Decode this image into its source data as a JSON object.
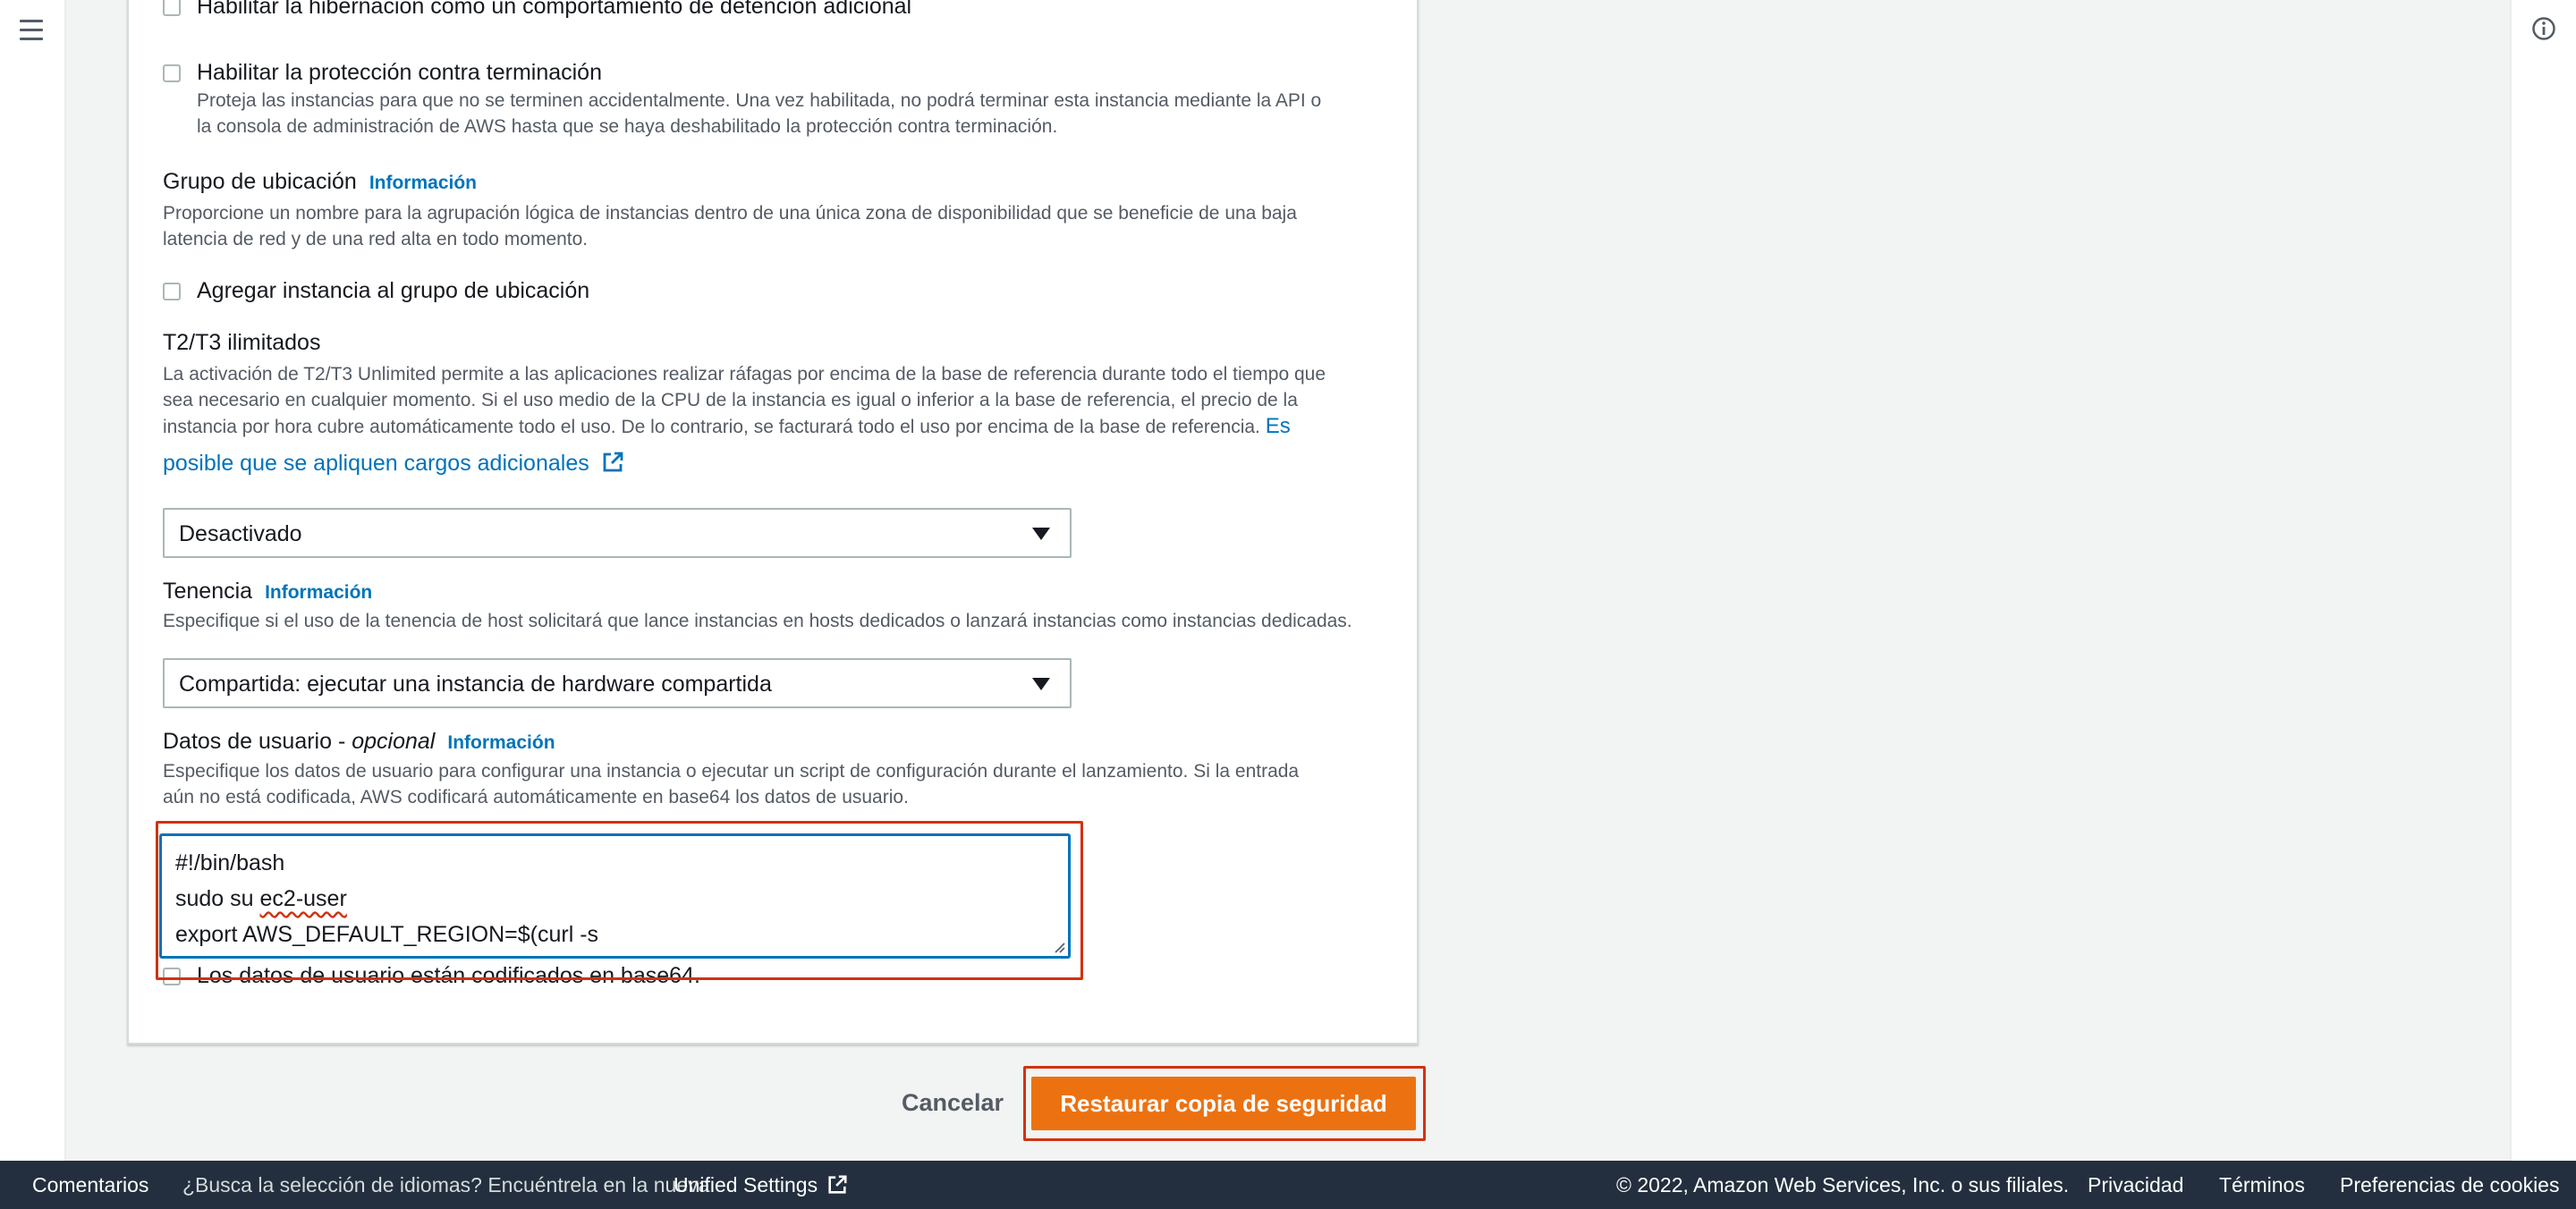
{
  "hibernation": {
    "label": "Habilitar la hibernación como un comportamiento de detención adicional"
  },
  "termination": {
    "label": "Habilitar la protección contra terminación",
    "desc_1": "Proteja las instancias para que no se terminen accidentalmente. Una vez habilitada, no podrá terminar esta instancia mediante la API o",
    "desc_2": "la consola de administración de AWS hasta que se haya deshabilitado la protección contra terminación."
  },
  "placement": {
    "title": "Grupo de ubicación",
    "info": "Información",
    "desc_1": "Proporcione un nombre para la agrupación lógica de instancias dentro de una única zona de disponibilidad que se beneficie de una baja",
    "desc_2": "latencia de red y de una red alta en todo momento.",
    "checkbox_label": "Agregar instancia al grupo de ubicación"
  },
  "unlimited": {
    "title": "T2/T3 ilimitados",
    "desc_1": "La activación de T2/T3 Unlimited permite a las aplicaciones realizar ráfagas por encima de la base de referencia durante todo el tiempo que",
    "desc_2": "sea necesario en cualquier momento. Si el uso medio de la CPU de la instancia es igual o inferior a la base de referencia, el precio de la",
    "desc_3": "instancia por hora cubre automáticamente todo el uso. De lo contrario, se facturará todo el uso por encima de la base de referencia.",
    "link_1": "Es",
    "link_2": "posible que se apliquen cargos adicionales",
    "select_value": "Desactivado"
  },
  "tenancy": {
    "title": "Tenencia",
    "info": "Información",
    "desc": "Especifique si el uso de la tenencia de host solicitará que lance instancias en hosts dedicados o lanzará instancias como instancias dedicadas.",
    "select_value": "Compartida: ejecutar una instancia de hardware compartida"
  },
  "userdata": {
    "title": "Datos de usuario - ",
    "title_optional": "opcional",
    "info": "Información",
    "desc_1": "Especifique los datos de usuario para configurar una instancia o ejecutar un script de configuración durante el lanzamiento. Si la entrada",
    "desc_2": "aún no está codificada, AWS codificará automáticamente en base64 los datos de usuario.",
    "line_1": "#!/bin/bash",
    "line_2a": "sudo su ",
    "line_2b": "ec2-user",
    "line_3": "export AWS_DEFAULT_REGION=$(curl -s",
    "base64_label": "Los datos de usuario están codificados en base64."
  },
  "actions": {
    "cancel": "Cancelar",
    "restore": "Restaurar copia de seguridad"
  },
  "footer": {
    "feedback": "Comentarios",
    "lang_prompt": "¿Busca la selección de idiomas? Encuéntrela en la nueva",
    "unified": "Unified Settings",
    "copyright": "© 2022, Amazon Web Services, Inc. o sus filiales.",
    "privacy": "Privacidad",
    "terms": "Términos",
    "cookies": "Preferencias de cookies"
  },
  "colors": {
    "accent": "#0073bb",
    "primary": "#ec7211",
    "highlight": "#d13212",
    "footer": "#232f3e"
  }
}
